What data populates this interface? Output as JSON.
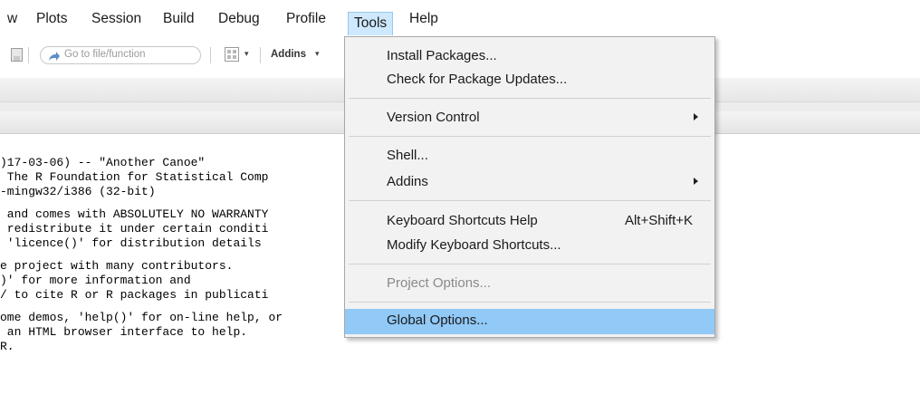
{
  "menubar": {
    "items": [
      "w",
      "Plots",
      "Session",
      "Build",
      "Debug",
      "Profile",
      "Tools",
      "Help"
    ],
    "active": "Tools"
  },
  "toolbar": {
    "goto_placeholder": "Go to file/function",
    "addins_label": "Addins",
    "dropdown_arrow": "▾"
  },
  "console": {
    "lines": [
      ")17-03-06) -- \"Another Canoe\"",
      " The R Foundation for Statistical Comp",
      "-mingw32/i386 (32-bit)",
      "",
      " and comes with ABSOLUTELY NO WARRANTY",
      " redistribute it under certain conditi",
      " 'licence()' for distribution details",
      "",
      "e project with many contributors.",
      ")' for more information and",
      "/ to cite R or R packages in publicati",
      "",
      "ome demos, 'help()' for on-line help, or",
      " an HTML browser interface to help.",
      "R."
    ]
  },
  "tools_menu": {
    "install_packages": "Install Packages...",
    "check_updates": "Check for Package Updates...",
    "version_control": "Version Control",
    "shell": "Shell...",
    "addins": "Addins",
    "keyboard_help": "Keyboard Shortcuts Help",
    "keyboard_help_shortcut": "Alt+Shift+K",
    "modify_shortcuts": "Modify Keyboard Shortcuts...",
    "project_options": "Project Options...",
    "global_options": "Global Options..."
  },
  "colors": {
    "highlight": "#91c9f7",
    "menu_bg": "#f2f2f2",
    "active_menu": "#cde8ff"
  }
}
